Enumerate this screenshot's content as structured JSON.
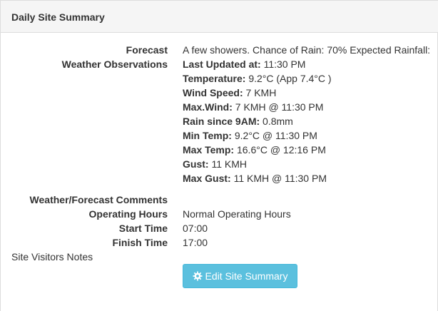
{
  "panel": {
    "title": "Daily Site Summary"
  },
  "forecast": {
    "label": "Forecast",
    "value": "A few showers. Chance of Rain: 70% Expected Rainfall:"
  },
  "observations": {
    "label": "Weather Observations",
    "items": [
      {
        "key": "Last Updated at:",
        "value": " 11:30 PM"
      },
      {
        "key": "Temperature:",
        "value": " 9.2°C (App 7.4°C )"
      },
      {
        "key": "Wind Speed:",
        "value": " 7 KMH"
      },
      {
        "key": "Max.Wind:",
        "value": " 7 KMH @ 11:30 PM"
      },
      {
        "key": "Rain since 9AM:",
        "value": " 0.8mm"
      },
      {
        "key": "Min Temp:",
        "value": " 9.2°C @ 11:30 PM"
      },
      {
        "key": "Max Temp:",
        "value": " 16.6°C @ 12:16 PM"
      },
      {
        "key": "Gust:",
        "value": " 11 KMH"
      },
      {
        "key": "Max Gust:",
        "value": " 11 KMH @ 11:30 PM"
      }
    ]
  },
  "comments": {
    "label": "Weather/Forecast Comments",
    "value": ""
  },
  "operating_hours": {
    "label": "Operating Hours",
    "value": "Normal Operating Hours"
  },
  "start_time": {
    "label": "Start Time",
    "value": "07:00"
  },
  "finish_time": {
    "label": "Finish Time",
    "value": "17:00"
  },
  "site_visitors_notes": {
    "label": "Site Visitors Notes"
  },
  "edit_button": {
    "label": "Edit Site Summary",
    "icon": "cog-icon",
    "color": "#5bc0de"
  }
}
